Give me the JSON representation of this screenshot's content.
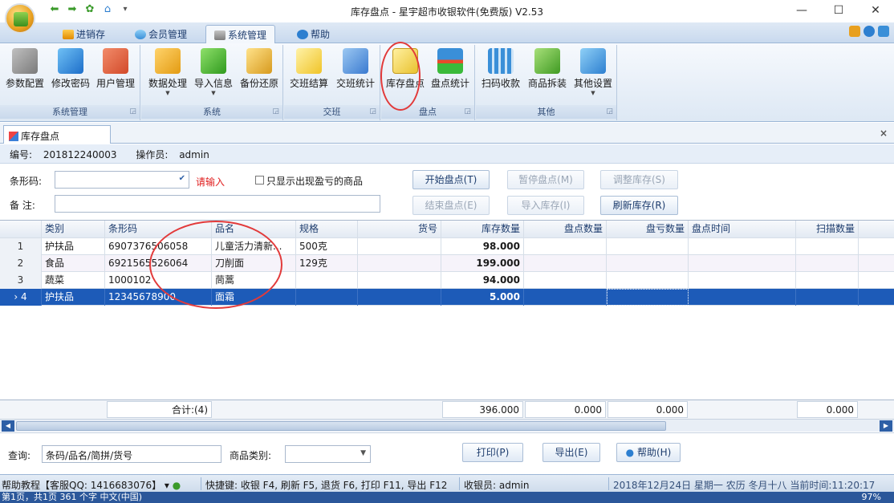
{
  "window": {
    "title": "库存盘点 - 星宇超市收银软件(免费版) V2.53",
    "controls": [
      "—",
      "☐",
      "✕"
    ]
  },
  "ribbon_tabs": [
    {
      "label": "进销存"
    },
    {
      "label": "会员管理"
    },
    {
      "label": "系统管理"
    },
    {
      "label": "帮助"
    }
  ],
  "ribbon_groups": [
    {
      "label": "系统管理",
      "buttons": [
        "参数配置",
        "修改密码",
        "用户管理"
      ]
    },
    {
      "label": "系统",
      "buttons": [
        "数据处理",
        "导入信息",
        "备份还原"
      ]
    },
    {
      "label": "交班",
      "buttons": [
        "交班结算",
        "交班统计"
      ]
    },
    {
      "label": "盘点",
      "buttons": [
        "库存盘点",
        "盘点统计"
      ]
    },
    {
      "label": "其他",
      "buttons": [
        "扫码收款",
        "商品拆装",
        "其他设置"
      ]
    }
  ],
  "doc_tab": {
    "label": "库存盘点",
    "close": "×"
  },
  "info": {
    "number_label": "编号:",
    "number": "201812240003",
    "operator_label": "操作员:",
    "operator": "admin"
  },
  "form": {
    "barcode_label": "条形码:",
    "barcode_hint": "请输入",
    "only_loss_label": "只显示出现盈亏的商品",
    "remark_label": "备  注:",
    "btn_start": "开始盘点(T)",
    "btn_pause": "暂停盘点(M)",
    "btn_adjust": "调整库存(S)",
    "btn_end": "结束盘点(E)",
    "btn_import": "导入库存(I)",
    "btn_refresh": "刷新库存(R)"
  },
  "grid": {
    "columns": [
      "类别",
      "条形码",
      "品名",
      "规格",
      "货号",
      "库存数量",
      "盘点数量",
      "盘亏数量",
      "盘点时间",
      "扫描数量"
    ],
    "rows": [
      {
        "idx": "1",
        "cat": "护扶品",
        "barcode": "6907376506058",
        "name": "儿童活力清新...",
        "spec": "500克",
        "code": "",
        "stock": "98.000",
        "count": "",
        "loss": "",
        "time": "",
        "scan": ""
      },
      {
        "idx": "2",
        "cat": "食品",
        "barcode": "6921565526064",
        "name": "刀削面",
        "spec": "129克",
        "code": "",
        "stock": "199.000",
        "count": "",
        "loss": "",
        "time": "",
        "scan": ""
      },
      {
        "idx": "3",
        "cat": "蔬菜",
        "barcode": "1000102",
        "name": "茼蒿",
        "spec": "",
        "code": "",
        "stock": "94.000",
        "count": "",
        "loss": "",
        "time": "",
        "scan": ""
      },
      {
        "idx": "4",
        "cat": "护扶品",
        "barcode": "12345678900",
        "name": "面霜",
        "spec": "",
        "code": "",
        "stock": "5.000",
        "count": "",
        "loss": "",
        "time": "",
        "scan": "",
        "selected": true
      }
    ],
    "totals": {
      "label": "合计:(4)",
      "stock": "396.000",
      "count": "0.000",
      "loss": "0.000",
      "scan": "0.000"
    }
  },
  "query": {
    "label": "查询:",
    "value": "条码/品名/简拼/货号",
    "category_label": "商品类别:",
    "btn_print": "打印(P)",
    "btn_export": "导出(E)",
    "btn_help": "帮助(H)"
  },
  "status": {
    "help": "帮助教程【客服QQ: 1416683076】",
    "shortcuts": "快捷键: 收银 F4, 刷新 F5, 退货 F6, 打印 F11, 导出 F12",
    "cashier": "收银员: admin",
    "datetime": "2018年12月24日 星期一 农历 冬月十八 当前时间:11:20:17"
  },
  "taskbar": {
    "left": "第1页，共1页   361 个字   中文(中国)",
    "zoom": "97%"
  },
  "colors": {
    "selection": "#1d5bb8",
    "annotation": "#e23a3a",
    "hint": "#e02020"
  }
}
